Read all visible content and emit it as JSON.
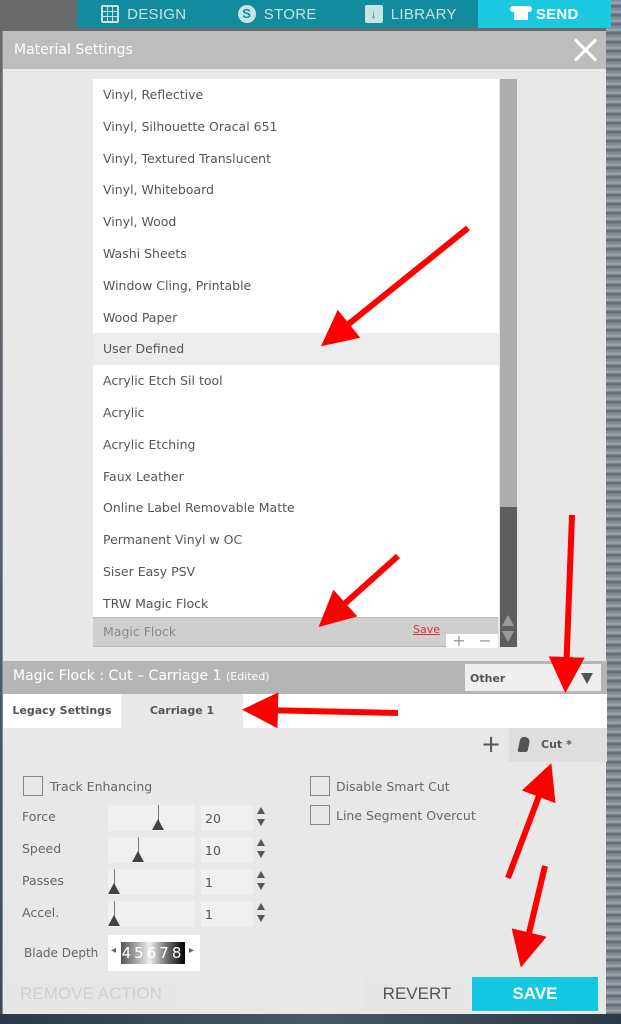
{
  "topnav": {
    "tabs": [
      {
        "label": "DESIGN",
        "icon": "grid-icon",
        "active": false
      },
      {
        "label": "STORE",
        "icon": "store-icon",
        "active": false
      },
      {
        "label": "LIBRARY",
        "icon": "library-icon",
        "active": false
      },
      {
        "label": "SEND",
        "icon": "send-icon",
        "active": true
      }
    ]
  },
  "dialog": {
    "title": "Material Settings",
    "close_icon": "close-icon"
  },
  "materials": {
    "items": [
      "Vinyl, Reflective",
      "Vinyl, Silhouette Oracal 651",
      "Vinyl, Textured Translucent",
      "Vinyl, Whiteboard",
      "Vinyl, Wood",
      "Washi Sheets",
      "Window Cling, Printable",
      "Wood Paper",
      "User Defined",
      "Acrylic Etch Sil tool",
      "Acrylic",
      "Acrylic Etching",
      "Faux Leather",
      "Online Label Removable Matte",
      "Permanent Vinyl w OC",
      "Siser Easy PSV",
      "TRW Magic Flock"
    ],
    "highlighted": "User Defined",
    "edit_name": "Magic Flock",
    "edit_save_label": "Save",
    "add_label": "+",
    "remove_label": "−"
  },
  "material_bar": {
    "title": "Magic Flock : Cut – Carriage 1",
    "edited_label": "(Edited)",
    "category_value": "Other"
  },
  "tabs": {
    "legacy": "Legacy Settings",
    "carriage": "Carriage 1"
  },
  "actions": {
    "add_label": "+",
    "cut_label": "Cut *"
  },
  "settings": {
    "track_enhancing": {
      "label": "Track Enhancing",
      "checked": false
    },
    "disable_smart_cut": {
      "label": "Disable Smart Cut",
      "checked": false
    },
    "line_segment_overcut": {
      "label": "Line Segment Overcut",
      "checked": false
    },
    "sliders": [
      {
        "label": "Force",
        "value": "20",
        "fraction": 0.6
      },
      {
        "label": "Speed",
        "value": "10",
        "fraction": 0.33
      },
      {
        "label": "Passes",
        "value": "1",
        "fraction": 0.0
      },
      {
        "label": "Accel.",
        "value": "1",
        "fraction": 0.0
      }
    ],
    "blade_depth": {
      "label": "Blade Depth",
      "dial_text": "45678"
    }
  },
  "buttons": {
    "remove_action": "REMOVE ACTION",
    "revert": "REVERT",
    "save": "SAVE"
  },
  "colors": {
    "accent": "#15c8e2",
    "nav": "#128c9c",
    "annotation": "#ff0000"
  }
}
